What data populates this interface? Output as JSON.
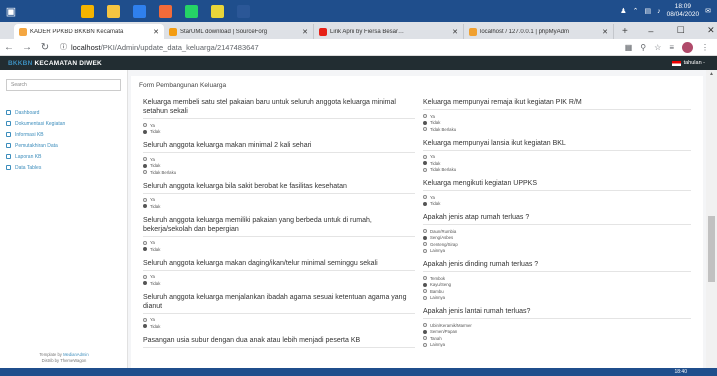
{
  "taskbar": {
    "start_icon": "windows-icon",
    "apps": [
      {
        "name": "search-icon",
        "color": "#1f4e8c"
      },
      {
        "name": "task-view-icon",
        "color": "#1f4e8c"
      },
      {
        "name": "chrome-icon",
        "color": "#f4b400"
      },
      {
        "name": "file-explorer-icon",
        "color": "#f5c542"
      },
      {
        "name": "vscode-icon",
        "color": "#2f80ed"
      },
      {
        "name": "xampp-icon",
        "color": "#f26b3a"
      },
      {
        "name": "whatsapp-icon",
        "color": "#25d366"
      },
      {
        "name": "sticky-notes-icon",
        "color": "#e9d539"
      },
      {
        "name": "word-icon",
        "color": "#2b5797"
      }
    ],
    "clock_time": "18:09",
    "clock_date": "08/04/2020",
    "bottom_time": "18:40"
  },
  "browser": {
    "tabs": [
      {
        "title": "KADER PPKBD BKKBN Kecamata",
        "active": true,
        "color": "#f4a742"
      },
      {
        "title": "StarUML download | SourceForg",
        "active": false,
        "color": "#f39c12"
      },
      {
        "title": "Lirik Aprii by Fiersa Besar…",
        "active": false,
        "color": "#e62117"
      },
      {
        "title": "localhost / 127.0.0.1 | phpMyAdm",
        "active": false,
        "color": "#f0a030"
      }
    ],
    "new_tab": "+",
    "url_host": "localhost",
    "url_path": "/PKI/Admin/update_data_keluarga/2147483647",
    "window_controls": [
      "–",
      "☐",
      "✕"
    ]
  },
  "app": {
    "brand_prefix": "BKKBN",
    "brand_name": " KECAMATAN DIWEK",
    "user_label": "tahulan -"
  },
  "sidebar": {
    "search_placeholder": "Search",
    "items": [
      {
        "label": "Dashboard",
        "icon": "dashboard-icon"
      },
      {
        "label": "Dokumentasi Kegiatan",
        "icon": "document-icon"
      },
      {
        "label": "Informasi KB",
        "icon": "info-icon"
      },
      {
        "label": "Pemutakhiran Data",
        "icon": "refresh-icon"
      },
      {
        "label": "Laporan KB",
        "icon": "report-icon"
      },
      {
        "label": "Data Tables",
        "icon": "table-icon"
      }
    ],
    "footer_line1_prefix": "Template by",
    "footer_line1_link": "MedianAdmin",
    "footer_line2": "Distrib by ThemeWagon"
  },
  "form": {
    "title": "Form Pembangunan Keluarga",
    "left_questions": [
      {
        "text": "Keluarga membeli satu stel pakaian baru untuk seluruh anggota keluarga minimal setahun sekali",
        "options": [
          {
            "label": "Ya",
            "checked": false
          },
          {
            "label": "Tidak",
            "checked": true
          }
        ]
      },
      {
        "text": "Seluruh anggota keluarga makan minimal 2 kali sehari",
        "options": [
          {
            "label": "Ya",
            "checked": false
          },
          {
            "label": "Tidak",
            "checked": true
          },
          {
            "label": "Tidak Berlaku",
            "checked": false
          }
        ]
      },
      {
        "text": "Seluruh anggota keluarga bila sakit berobat ke fasilitas kesehatan",
        "options": [
          {
            "label": "Ya",
            "checked": false
          },
          {
            "label": "Tidak",
            "checked": true
          }
        ]
      },
      {
        "text": "Seluruh anggota keluarga memiliki pakaian yang berbeda untuk di rumah, bekerja/sekolah dan bepergian",
        "options": [
          {
            "label": "Ya",
            "checked": false
          },
          {
            "label": "Tidak",
            "checked": true
          }
        ]
      },
      {
        "text": "Seluruh anggota keluarga makan daging/ikan/telur minimal seminggu sekali",
        "options": [
          {
            "label": "Ya",
            "checked": false
          },
          {
            "label": "Tidak",
            "checked": true
          }
        ]
      },
      {
        "text": "Seluruh anggota keluarga menjalankan ibadah agama sesuai ketentuan agama yang dianut",
        "options": [
          {
            "label": "Ya",
            "checked": false
          },
          {
            "label": "Tidak",
            "checked": true
          }
        ]
      },
      {
        "text": "Pasangan usia subur dengan dua anak atau lebih menjadi peserta KB",
        "options": []
      }
    ],
    "right_questions": [
      {
        "text": "Keluarga mempunyai remaja ikut kegiatan PIK R/M",
        "options": [
          {
            "label": "Ya",
            "checked": false
          },
          {
            "label": "Tidak",
            "checked": true
          },
          {
            "label": "Tidak Berlaku",
            "checked": false
          }
        ]
      },
      {
        "text": "Keluarga mempunyai lansia ikut kegiatan BKL",
        "options": [
          {
            "label": "Ya",
            "checked": false
          },
          {
            "label": "Tidak",
            "checked": true
          },
          {
            "label": "Tidak Berlaku",
            "checked": false
          }
        ]
      },
      {
        "text": "Keluarga mengikuti kegiatan UPPKS",
        "options": [
          {
            "label": "Ya",
            "checked": false
          },
          {
            "label": "Tidak",
            "checked": true
          }
        ]
      },
      {
        "text": "Apakah jenis atap rumah terluas ?",
        "options": [
          {
            "label": "Daun/Rumbia",
            "checked": false
          },
          {
            "label": "Seng/Asbes",
            "checked": true
          },
          {
            "label": "Genteng/Sirap",
            "checked": false
          },
          {
            "label": "Lainnya",
            "checked": false
          }
        ]
      },
      {
        "text": "Apakah jenis dinding rumah terluas ?",
        "options": [
          {
            "label": "Tembok",
            "checked": false
          },
          {
            "label": "Kayu/Seng",
            "checked": true
          },
          {
            "label": "Bambu",
            "checked": false
          },
          {
            "label": "Lainnya",
            "checked": false
          }
        ]
      },
      {
        "text": "Apakah jenis lantai rumah terluas?",
        "options": [
          {
            "label": "Ubin/Keramik/Marmer",
            "checked": false
          },
          {
            "label": "Semen/Papan",
            "checked": true
          },
          {
            "label": "Tanah",
            "checked": false
          },
          {
            "label": "Lainnya",
            "checked": false
          }
        ]
      }
    ]
  }
}
